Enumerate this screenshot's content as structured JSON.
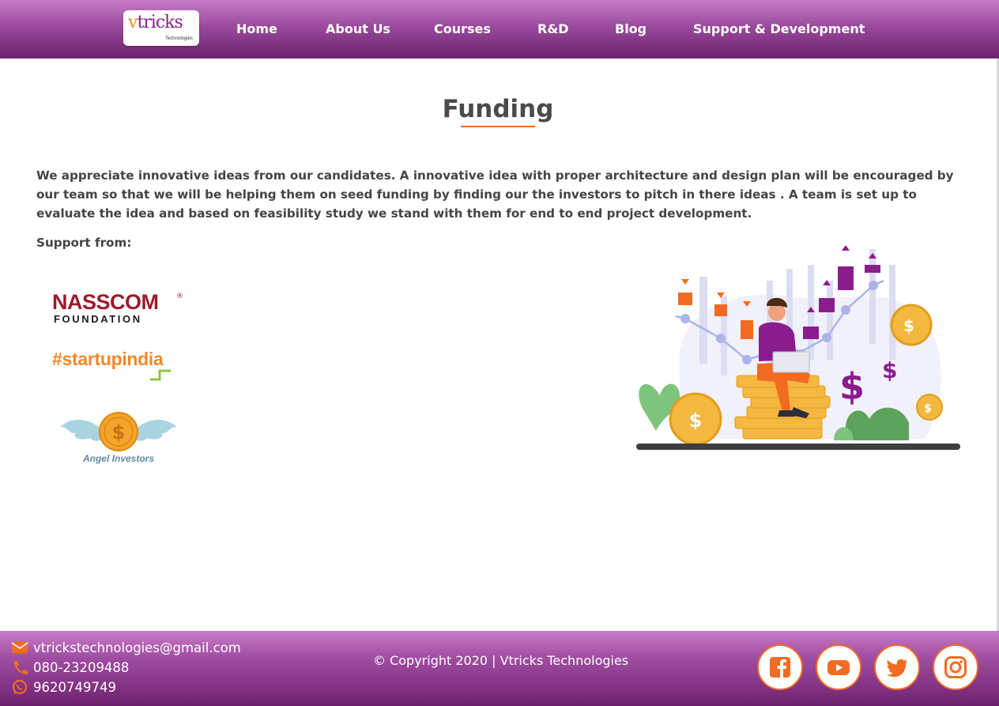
{
  "header": {
    "logo_text_v": "v",
    "logo_text_rest": "tricks",
    "logo_sub": "Technologies",
    "nav": [
      "Home",
      "About Us",
      "Courses",
      "R&D",
      "Blog",
      "Support & Development"
    ]
  },
  "main": {
    "title": "Funding",
    "paragraph": "We appreciate innovative ideas from our candidates. A innovative idea with proper architecture and design plan will be encouraged by our team so that we will be helping them on seed funding by finding our the investors to pitch in there ideas . A team is set up to evaluate the idea and based on feasibility study we stand with them for end to end project development.",
    "support_label": "Support from:",
    "partners": {
      "nasscom_top": "NASSCOM",
      "nasscom_reg": "®",
      "nasscom_bottom": "FOUNDATION",
      "startup": "#startupindia",
      "angel": "Angel Investors"
    },
    "illustration_symbols": [
      "$",
      "$",
      "$",
      "$",
      "$"
    ]
  },
  "footer": {
    "email": "vtrickstechnologies@gmail.com",
    "phone": "080-23209488",
    "whatsapp": "9620749749",
    "copyright": "© Copyright 2020 | Vtricks Technologies",
    "social": [
      "facebook-icon",
      "youtube-icon",
      "twitter-icon",
      "instagram-icon"
    ]
  },
  "colors": {
    "header_top": "#c87bc6",
    "header_bottom": "#6e216f",
    "accent_orange": "#f26b21",
    "text_dark": "#444444",
    "purple": "#8a1d8e"
  }
}
